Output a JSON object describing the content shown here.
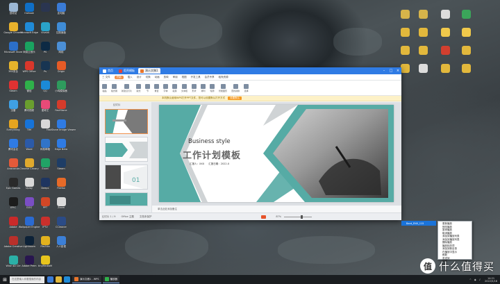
{
  "desktop_left": [
    {
      "label": "回收站",
      "color": "#9bb7d4"
    },
    {
      "label": "Outlook",
      "color": "#0f6fc6"
    },
    {
      "label": "",
      "color": "#2a3550"
    },
    {
      "label": "此电脑",
      "color": "#3a7bd5"
    },
    {
      "label": "Google Chrome",
      "color": "#e8b22c"
    },
    {
      "label": "Microsoft Edge",
      "color": "#1f8bd8"
    },
    {
      "label": "Vivaldi",
      "color": "#2aa3c9"
    },
    {
      "label": "控制面板",
      "color": "#3f8cd6"
    },
    {
      "label": "Microsoft Store",
      "color": "#2c6fc8"
    },
    {
      "label": "网易云音乐",
      "color": "#1aa260"
    },
    {
      "label": "PS",
      "color": "#0d2a44"
    },
    {
      "label": "网络",
      "color": "#4b8fd6"
    },
    {
      "label": "360安全",
      "color": "#e6b42b"
    },
    {
      "label": "WPS Office",
      "color": "#d8372b"
    },
    {
      "label": "Ps",
      "color": "#183552"
    },
    {
      "label": "Origin",
      "color": "#e65b26"
    },
    {
      "label": "Steam",
      "color": "#e03232"
    },
    {
      "label": "微信",
      "color": "#2fb14a"
    },
    {
      "label": "QQ",
      "color": "#1b8ad8"
    },
    {
      "label": "小鸡模拟器",
      "color": "#2e9b5d"
    },
    {
      "label": "迅雷",
      "color": "#3fa0e4"
    },
    {
      "label": "腾讯视频",
      "color": "#6a9e2e"
    },
    {
      "label": "爱奇艺",
      "color": "#e94a78"
    },
    {
      "label": "FastStone",
      "color": "#d53b2b"
    },
    {
      "label": "Everything",
      "color": "#e6a51f"
    },
    {
      "label": "TIM",
      "color": "#1673d8"
    },
    {
      "label": "",
      "color": "#d8d8d8"
    },
    {
      "label": "FastStone Image Viewer",
      "color": "#2f7be4"
    },
    {
      "label": "腾讯会议",
      "color": "#2f7be4"
    },
    {
      "label": "Word",
      "color": "#2b5aa8"
    },
    {
      "label": "网易邮箱",
      "color": "#3074c9"
    },
    {
      "label": "Edge Beta",
      "color": "#2f7be4"
    },
    {
      "label": "Anaconda",
      "color": "#e45a39"
    },
    {
      "label": "Chrome Canary",
      "color": "#e0a92d"
    },
    {
      "label": "Excel",
      "color": "#21a366"
    },
    {
      "label": "Steam",
      "color": "#1e3d66"
    },
    {
      "label": "Epic Games",
      "color": "#2a2a2a"
    },
    {
      "label": "Uplay",
      "color": "#d8d8d8"
    },
    {
      "label": "DeepL",
      "color": "#1e3560"
    },
    {
      "label": "Firefox",
      "color": "#e66a28"
    },
    {
      "label": "EPIC",
      "color": "#1c1c1c"
    },
    {
      "label": "GOG",
      "color": "#7a4ec4"
    },
    {
      "label": "PPT",
      "color": "#d24726"
    },
    {
      "label": "Zoom",
      "color": "#dcdcdc"
    },
    {
      "label": "Adobe",
      "color": "#c92a2a"
    },
    {
      "label": "Wallpaper Engine",
      "color": "#2a6ad1"
    },
    {
      "label": "IPTV",
      "color": "#c9302c"
    },
    {
      "label": "CCleaner",
      "color": "#2b4b86"
    },
    {
      "label": "Adobe Creative",
      "color": "#b9302b"
    },
    {
      "label": "Lightroom",
      "color": "#0d2238"
    },
    {
      "label": "FileZilla",
      "color": "#e2b21e"
    },
    {
      "label": "人人影视",
      "color": "#3c7fd6"
    },
    {
      "label": "Wise 4D Cle",
      "color": "#2bb0a7"
    },
    {
      "label": "Adobe Prem",
      "color": "#28164f"
    },
    {
      "label": "tinyMediaM",
      "color": "#e8c51d"
    }
  ],
  "desktop_right": [
    {
      "label": "",
      "color": "#d6b44a"
    },
    {
      "label": "",
      "color": "#d6b44a"
    },
    {
      "label": "",
      "color": "#dcdcdc"
    },
    {
      "label": "",
      "color": "#3ba55a"
    },
    {
      "label": "",
      "color": "#e2b83c"
    },
    {
      "label": "",
      "color": "#e2b83c"
    },
    {
      "label": "",
      "color": "#f0c94b"
    },
    {
      "label": "",
      "color": "#f0c94b"
    },
    {
      "label": "",
      "color": "#e2b83c"
    },
    {
      "label": "",
      "color": "#e2b83c"
    },
    {
      "label": "",
      "color": "#d23f2f"
    },
    {
      "label": "",
      "color": "#e2b83c"
    },
    {
      "label": "",
      "color": "#e2b83c"
    },
    {
      "label": "",
      "color": "#dcdcdc"
    },
    {
      "label": "",
      "color": "#e2b83c"
    },
    {
      "label": "",
      "color": "#e2b83c"
    }
  ],
  "window": {
    "tabs": [
      {
        "label": "首页",
        "color": "#ffffff",
        "active": false
      },
      {
        "label": "稻壳模板",
        "color": "#e0443a",
        "active": false
      },
      {
        "label": "演示文稿1",
        "color": "#e8752b",
        "active": true
      }
    ],
    "menu": [
      "三 文件",
      "开始",
      "插入",
      "设计",
      "切换",
      "动画",
      "放映",
      "审阅",
      "视图",
      "开发工具",
      "会员专享",
      "稻壳资源"
    ],
    "toolbar": [
      "粘贴",
      "格式刷",
      "新建幻灯片",
      "版式",
      "节",
      "重置",
      "字体",
      "段落",
      "文本框",
      "形状",
      "排列",
      "轮廓",
      "智能图形",
      "查找替换",
      "选择"
    ],
    "notice": "本机默认使用WPS打开PPT文件，您可以设置默认打开方式",
    "notice_btn": "设置默认",
    "thumbs_header": "幻灯片",
    "slide": {
      "title_en": "Business style",
      "title_cn": "工作计划模板",
      "reporter": "汇报人：XXX",
      "date": "汇报日期：2022.X"
    },
    "notes": "单击此处添加备注",
    "status": [
      "幻灯片 1 / 9",
      "Office 主题",
      "文档未保护"
    ],
    "zoom": "87%"
  },
  "context_menu": {
    "selected": "Bard_EN0_115",
    "items": [
      "更新播放",
      "修改播放",
      "暂停播放",
      "取消播放",
      "添加到播放列表",
      "添加到播放列表",
      "删除播放",
      "播放相关项",
      "添加到新目录",
      "在播放中显示",
      "刷新",
      "发送到",
      "新建",
      "属性"
    ]
  },
  "taskbar": {
    "search": "在这里输入你要搜索的内容",
    "apps": [
      {
        "label": "演示文稿1 - WPS",
        "color": "#e8752b"
      },
      {
        "label": "播放器",
        "color": "#2fb14a"
      }
    ],
    "time": "14:21",
    "date": "2022/5/18"
  },
  "watermark": {
    "symbol": "值",
    "text": "什么值得买"
  }
}
